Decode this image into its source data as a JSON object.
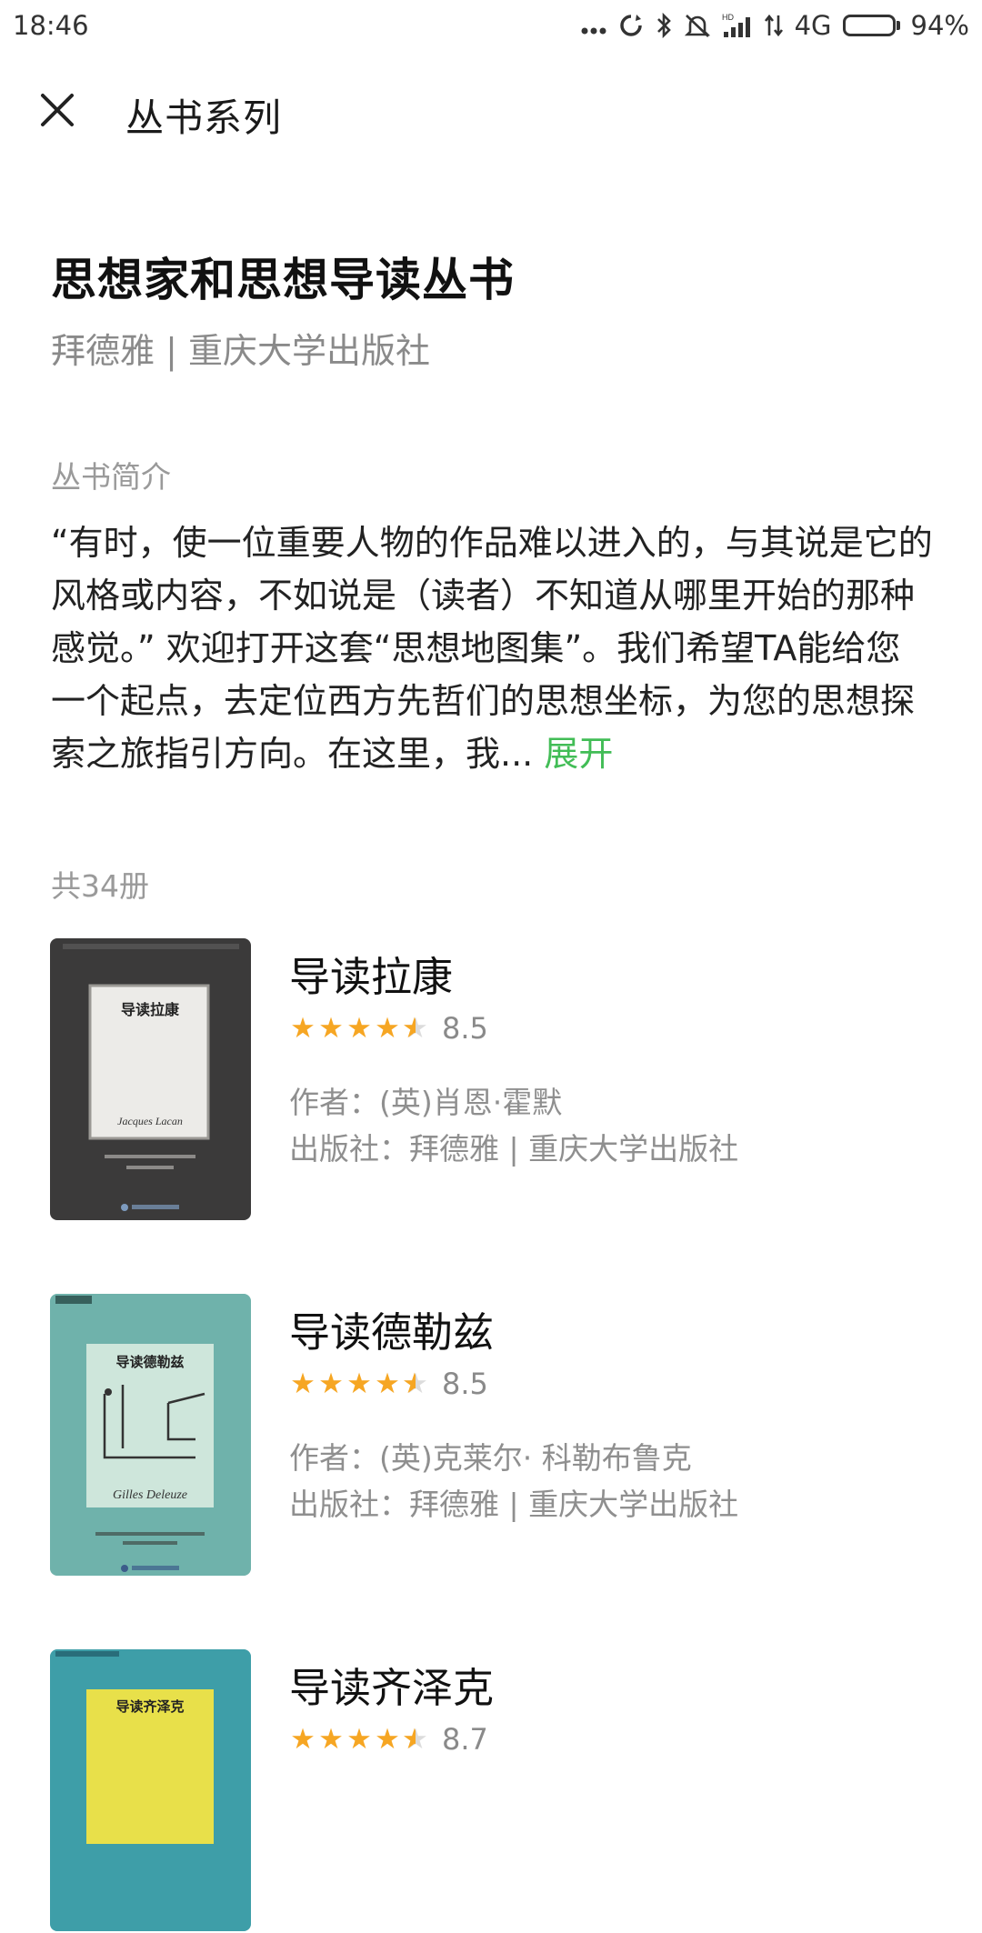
{
  "status_bar": {
    "time": "18:46",
    "network": "4G",
    "battery_percent": "94%",
    "battery_level": 0.94,
    "icons": [
      "more-dots-icon",
      "sync-icon",
      "bluetooth-icon",
      "alarm-off-icon",
      "hd-signal-icon",
      "data-arrows-icon"
    ]
  },
  "header": {
    "close_icon": "close-icon",
    "title": "丛书系列"
  },
  "series": {
    "title": "思想家和思想导读丛书",
    "subtitle": "拜德雅 | 重庆大学出版社",
    "intro_label": "丛书简介",
    "intro_text": "“有时，使一位重要人物的作品难以进入的，与其说是它的风格或内容，不如说是（读者）不知道从哪里开始的那种感觉。” 欢迎打开这套“思想地图集”。我们希望TA能给您一个起点，去定位西方先哲们的思想坐标，为您的思想探索之旅指引方向。在这里，我... ",
    "expand_label": "展开",
    "count_label": "共34册"
  },
  "books": [
    {
      "name": "导读拉康",
      "rating": "8.5",
      "stars": 4.5,
      "author": "作者：(英)肖恩·霍默",
      "publisher": "出版社：拜德雅 | 重庆大学出版社",
      "cover_title": "导读拉康",
      "cover_subtitle": "Jacques Lacan",
      "cover_bg": "#3b3a3a",
      "cover_inner": "#ecebe8"
    },
    {
      "name": "导读德勒兹",
      "rating": "8.5",
      "stars": 4.5,
      "author": "作者：(英)克莱尔· 科勒布鲁克",
      "publisher": "出版社：拜德雅 | 重庆大学出版社",
      "cover_title": "导读德勒兹",
      "cover_subtitle": "Gilles Deleuze",
      "cover_bg": "#5fa7a0",
      "cover_inner": "#d8ebe0"
    },
    {
      "name": "导读齐泽克",
      "rating": "8.7",
      "stars": 4.5,
      "author": "",
      "publisher": "",
      "cover_title": "导读齐泽克",
      "cover_subtitle": "",
      "cover_bg": "#2a8fa8",
      "cover_inner": "#e8e04a"
    }
  ],
  "colors": {
    "accent": "#42bd56",
    "star": "#f6a623"
  }
}
